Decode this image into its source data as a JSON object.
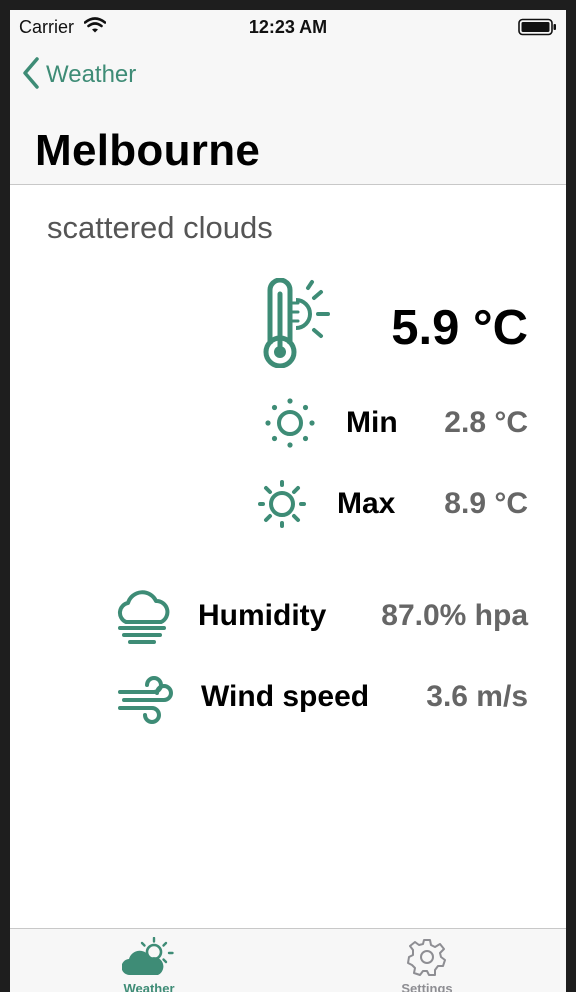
{
  "status_bar": {
    "carrier": "Carrier",
    "time": "12:23 AM"
  },
  "nav": {
    "back_label": "Weather",
    "title": "Melbourne"
  },
  "weather": {
    "description": "scattered clouds",
    "temperature": "5.9 °C",
    "min_label": "Min",
    "min_value": "2.8 °C",
    "max_label": "Max",
    "max_value": "8.9 °C",
    "humidity_label": "Humidity",
    "humidity_value": "87.0% hpa",
    "wind_label": "Wind speed",
    "wind_value": "3.6 m/s"
  },
  "tabs": [
    {
      "label": "Weather",
      "icon": "partly-cloudy-icon",
      "active": true
    },
    {
      "label": "Settings",
      "icon": "gear-icon",
      "active": false
    }
  ],
  "colors": {
    "accent": "#3e8c76",
    "inactive_tab": "#8e8e93",
    "value_text": "#666666"
  }
}
